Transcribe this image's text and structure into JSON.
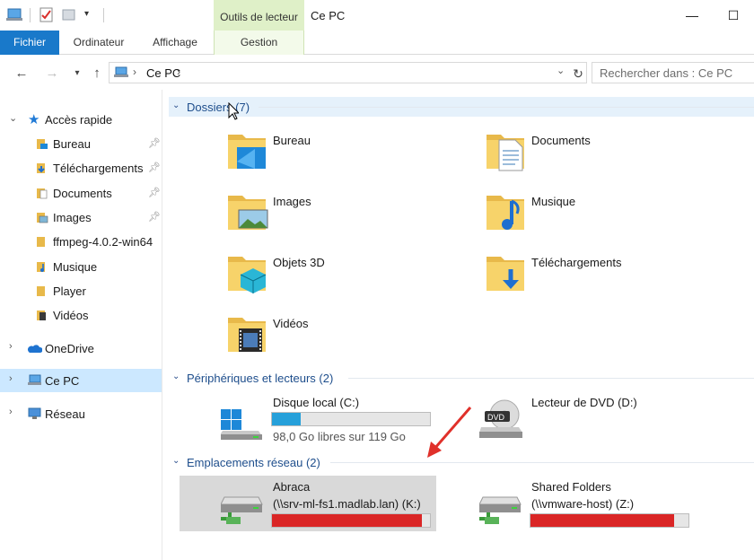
{
  "window": {
    "title": "Ce PC",
    "context_tab_header": "Outils de lecteur",
    "minimize_glyph": "—",
    "maximize_glyph": "☐"
  },
  "ribbon": {
    "tabs": [
      {
        "label": "Fichier",
        "active": true
      },
      {
        "label": "Ordinateur"
      },
      {
        "label": "Affichage"
      },
      {
        "label": "Gestion"
      }
    ]
  },
  "address": {
    "path": "Ce PC",
    "search_placeholder": "Rechercher dans : Ce PC"
  },
  "nav": {
    "quick_access": "Accès rapide",
    "items": [
      {
        "label": "Bureau",
        "pinned": true,
        "icon": "desktop-folder-icon"
      },
      {
        "label": "Téléchargements",
        "pinned": true,
        "icon": "downloads-folder-icon"
      },
      {
        "label": "Documents",
        "pinned": true,
        "icon": "documents-folder-icon"
      },
      {
        "label": "Images",
        "pinned": true,
        "icon": "pictures-folder-icon"
      },
      {
        "label": "ffmpeg-4.0.2-win64",
        "pinned": false,
        "icon": "folder-icon"
      },
      {
        "label": "Musique",
        "pinned": false,
        "icon": "music-folder-icon"
      },
      {
        "label": "Player",
        "pinned": false,
        "icon": "folder-icon"
      },
      {
        "label": "Vidéos",
        "pinned": false,
        "icon": "videos-folder-icon"
      }
    ],
    "onedrive": "OneDrive",
    "this_pc": "Ce PC",
    "network": "Réseau"
  },
  "content": {
    "groups": {
      "folders": "Dossiers (7)",
      "devices": "Périphériques et lecteurs (2)",
      "network": "Emplacements réseau (2)"
    },
    "folders": [
      {
        "label": "Bureau",
        "icon": "desktop-folder-icon"
      },
      {
        "label": "Documents",
        "icon": "documents-folder-icon"
      },
      {
        "label": "Images",
        "icon": "pictures-folder-icon"
      },
      {
        "label": "Musique",
        "icon": "music-folder-icon"
      },
      {
        "label": "Objets 3D",
        "icon": "3d-objects-folder-icon"
      },
      {
        "label": "Téléchargements",
        "icon": "downloads-folder-icon"
      },
      {
        "label": "Vidéos",
        "icon": "videos-folder-icon"
      }
    ],
    "devices": [
      {
        "label": "Disque local (C:)",
        "free_text": "98,0 Go libres sur 119 Go",
        "used_fraction": 0.18,
        "bar_color": "#26a0da"
      },
      {
        "label": "Lecteur de DVD (D:)",
        "icon": "dvd-drive-icon"
      }
    ],
    "network_locations": [
      {
        "label": "Abraca",
        "path": "(\\\\srv-ml-fs1.madlab.lan) (K:)",
        "used_fraction": 0.95,
        "bar_color": "#da2626",
        "selected": true
      },
      {
        "label": "Shared Folders",
        "path": "(\\\\vmware-host) (Z:)",
        "used_fraction": 0.91,
        "bar_color": "#da2626"
      }
    ]
  },
  "colors": {
    "accent": "#1979ca",
    "selection": "#cce8ff",
    "context_tab": "#dff0c8",
    "annotation_arrow": "#e0302a"
  }
}
